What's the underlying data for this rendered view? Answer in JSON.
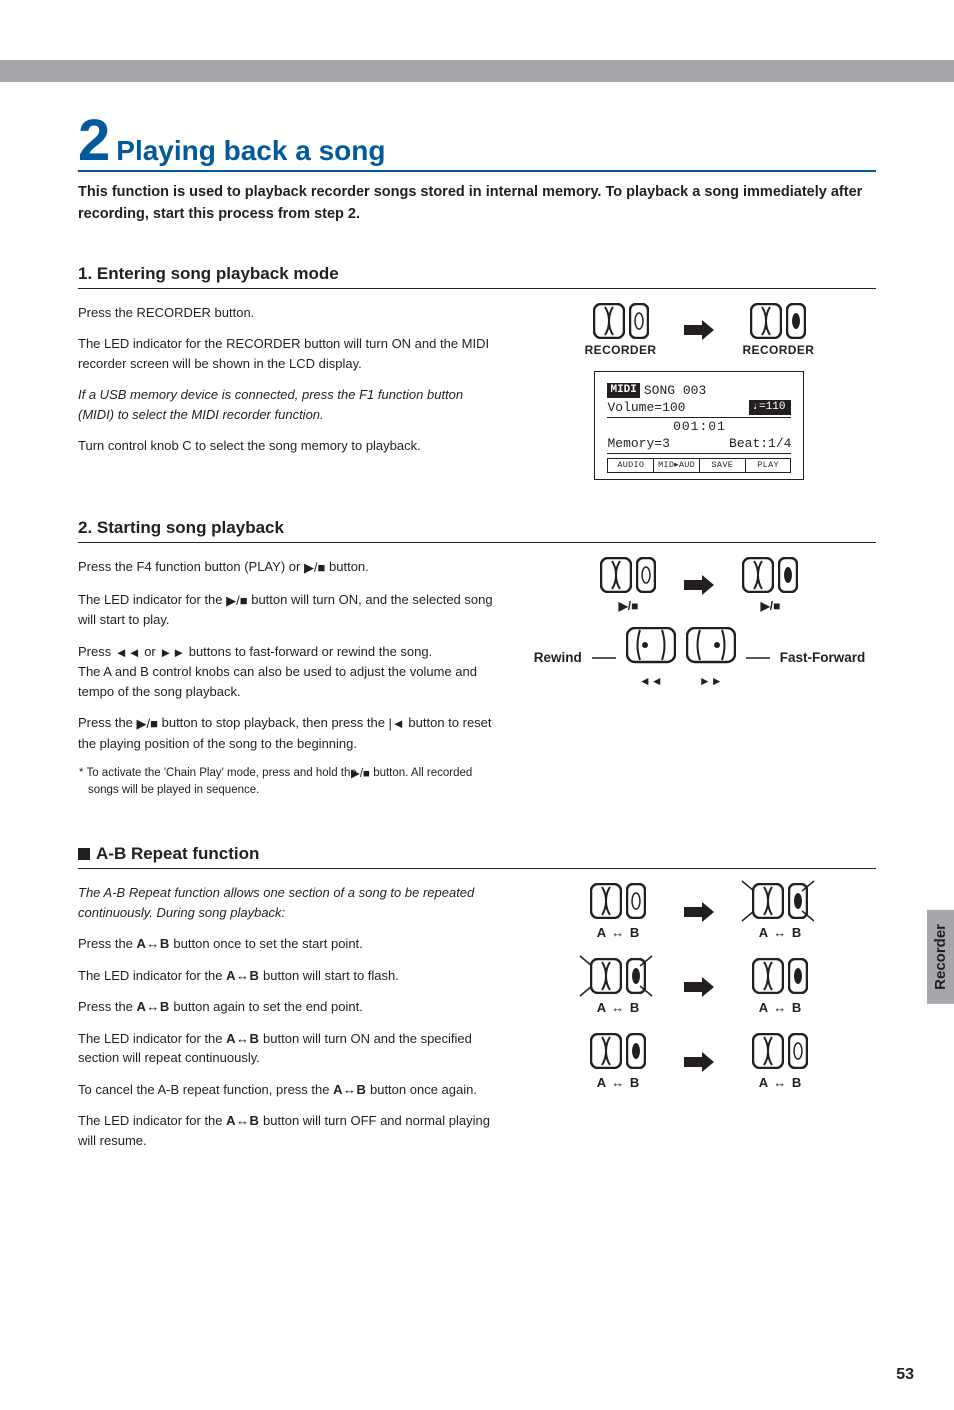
{
  "header_band": true,
  "title_number": "2",
  "title_text": "Playing back a song",
  "lede": "This function is used to playback recorder songs stored in internal memory.  To playback a song immediately after recording, start this process from step 2.",
  "section1": {
    "heading": "1. Entering song playback mode",
    "p1": "Press the RECORDER button.",
    "p2": "The LED indicator for the RECORDER button will turn ON and the MIDI recorder screen will be shown in the LCD display.",
    "p3": "If a USB memory device is connected, press the F1 function button (MIDI) to select the MIDI recorder function.",
    "p4": "Turn control knob C to select the song memory to playback.",
    "btn_label": "RECORDER",
    "lcd": {
      "mode_tag": "MIDI",
      "song": "SONG 003",
      "volume": "Volume=100",
      "tempo": "♩=110",
      "position": "001:01",
      "memory": "Memory=3",
      "beat": "Beat:1/4",
      "softkeys": [
        "AUDIO",
        "MID▸AUD",
        "SAVE",
        "PLAY"
      ]
    }
  },
  "section2": {
    "heading": "2. Starting song playback",
    "p1a": "Press the F4 function button (PLAY) or ",
    "p1b": " button.",
    "p2a": "The LED indicator for the ",
    "p2b": " button will turn ON, and the selected song will start to play.",
    "p3a": "Press ",
    "p3b": " or ",
    "p3c": " buttons to fast-forward or rewind the song.",
    "p3d": "The A and B control knobs can also be used to adjust the volume and tempo of the song playback.",
    "p4a": "Press the ",
    "p4b": " button to stop playback, then press the ",
    "p4c": " button to reset the playing position of the song to the beginning.",
    "fn_a": "*  To activate the 'Chain Play' mode, press and hold the ",
    "fn_b": " button. All recorded songs will be played in sequence.",
    "play_stop_glyph": "▶/■",
    "rewind_label": "Rewind",
    "ff_label": "Fast-Forward",
    "rw_glyph": "◄◄",
    "ff_glyph": "►►"
  },
  "ab": {
    "heading": "A-B Repeat function",
    "intro": "The A-B Repeat function allows one section of a song to be repeated continuously.  During song playback:",
    "p1a": "Press the ",
    "p1b": " button once to set the start point.",
    "p2a": "The LED indicator for the ",
    "p2b": " button will start to flash.",
    "p3a": "Press the ",
    "p3b": " button again to set the end point.",
    "p4a": "The LED indicator for the ",
    "p4b": " button will turn ON and the specified section will repeat continuously.",
    "p5a": "To cancel the A-B repeat function, press the ",
    "p5b": " button once again.",
    "p6a": "The LED indicator for the ",
    "p6b": " button will turn OFF and normal playing will resume.",
    "ab_label_text": "A ↔ B",
    "ab_inline": "A↔B"
  },
  "side_tab": "Recorder",
  "page_number": "53"
}
